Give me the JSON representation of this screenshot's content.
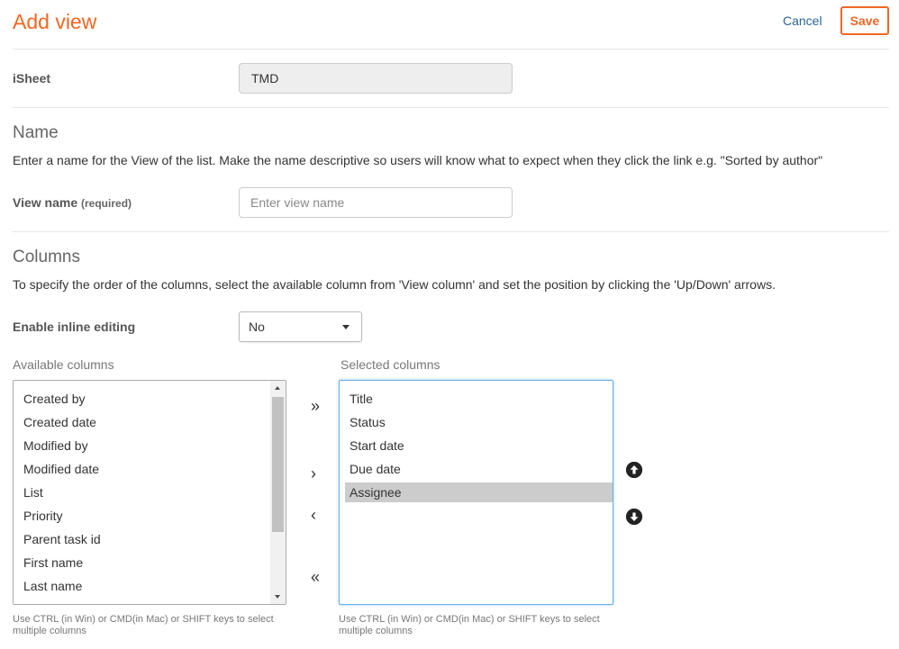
{
  "header": {
    "title": "Add view",
    "cancel_label": "Cancel",
    "save_label": "Save"
  },
  "isheet": {
    "label": "iSheet",
    "value": "TMD"
  },
  "name_section": {
    "heading": "Name",
    "description": "Enter a name for the View of the list. Make the name descriptive so users will know what to expect when they click the link e.g. \"Sorted by author\"",
    "view_name_label": "View name",
    "required_label": "(required)",
    "view_name_placeholder": "Enter view name",
    "view_name_value": ""
  },
  "columns_section": {
    "heading": "Columns",
    "description": "To specify the order of the columns, select the available column from 'View column' and set the position by clicking the 'Up/Down' arrows.",
    "inline_editing_label": "Enable inline editing",
    "inline_editing_value": "No",
    "available_title": "Available columns",
    "available_items": [
      "Created by",
      "Created date",
      "Modified by",
      "Modified date",
      "List",
      "Priority",
      "Parent task id",
      "First name",
      "Last name"
    ],
    "selected_title": "Selected columns",
    "selected_items": [
      "Title",
      "Status",
      "Start date",
      "Due date",
      "Assignee"
    ],
    "selected_highlight": "Assignee",
    "buttons": {
      "move_all_right": "»",
      "move_right": "›",
      "move_left": "‹",
      "move_all_left": "«"
    },
    "hint_available": "Use CTRL (in Win) or CMD(in Mac) or SHIFT keys to select multiple columns",
    "hint_selected": "Use CTRL (in Win) or CMD(in Mac) or SHIFT keys to select multiple columns"
  },
  "colors": {
    "accent": "#f26722",
    "link": "#2a6496",
    "focus_border": "#66afe9",
    "selected_row": "#cccccc"
  },
  "icons": {
    "move_up": "arrow-circle-up-icon",
    "move_down": "arrow-circle-down-icon"
  }
}
